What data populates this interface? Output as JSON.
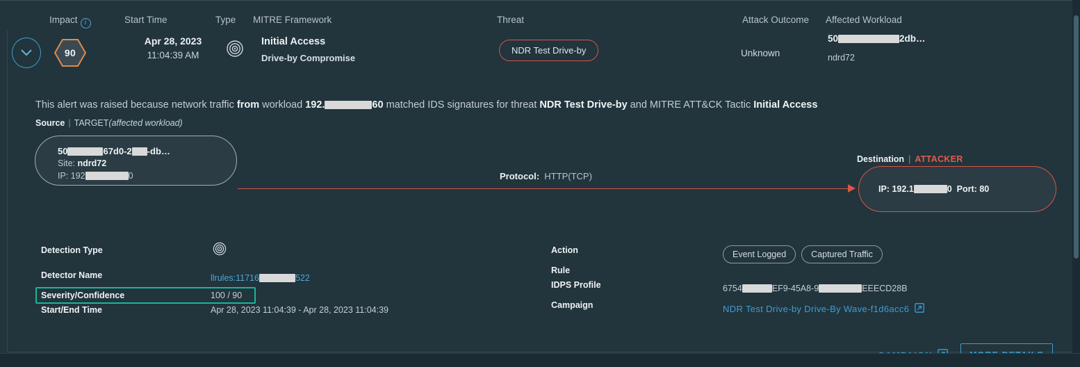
{
  "table_header": {
    "impact": "Impact",
    "impact_info_icon": "info-icon",
    "start_time": "Start Time",
    "type": "Type",
    "mitre_framework": "MITRE Framework",
    "threat": "Threat",
    "attack_outcome": "Attack Outcome",
    "affected_workload": "Affected Workload"
  },
  "row": {
    "expand_icon": "chevron-down-icon",
    "impact_score": "90",
    "start_date": "Apr 28, 2023",
    "start_time": "11:04:39 AM",
    "type_icon": "radar-target-icon",
    "mitre_tactic": "Initial Access",
    "mitre_technique": "Drive-by Compromise",
    "threat": "NDR Test Drive-by",
    "attack_outcome": "Unknown",
    "workload_id_prefix": "50",
    "workload_id_suffix": "2db…",
    "workload_site": "ndrd72"
  },
  "narrative": {
    "p1": "This alert was raised because network traffic ",
    "b1": "from",
    "p2": " workload ",
    "b2_prefix": "192.",
    "b2_suffix": "60",
    "p3": " matched IDS signatures for threat ",
    "b3": "NDR Test Drive-by",
    "p4": " and MITRE ATT&CK Tactic ",
    "b4": "Initial Access",
    "source_label": "Source",
    "target_label": "TARGET",
    "target_note": "(affected workload)"
  },
  "topology": {
    "source_node": {
      "name_prefix": "50",
      "name_mid": "67d0-2",
      "name_suffix": "-db…",
      "site_label": "Site:",
      "site_value": "ndrd72",
      "ip_label": "IP:",
      "ip_prefix": "192",
      "ip_suffix": "0"
    },
    "protocol_label": "Protocol:",
    "protocol_value": "HTTP(TCP)",
    "destination_label": "Destination",
    "destination_tag": "ATTACKER",
    "dest_node": {
      "ip_label": "IP:",
      "ip_prefix": "192.1",
      "ip_suffix": "0",
      "port_label": "Port:",
      "port_value": "80"
    }
  },
  "details_left": [
    {
      "label": "Detection Type",
      "value": "",
      "icon": "radar-target-icon"
    },
    {
      "label": "Detector Name",
      "value_prefix": "llrules:11716",
      "value_suffix": "522"
    },
    {
      "label": "Severity/Confidence",
      "value": "100 / 90",
      "highlighted": true
    },
    {
      "label": "Start/End Time",
      "value": "Apr 28, 2023 11:04:39 - Apr 28, 2023 11:04:39"
    }
  ],
  "details_right": [
    {
      "label": "Action",
      "chips": [
        "Event Logged",
        "Captured Traffic"
      ]
    },
    {
      "label": "Rule",
      "value": ""
    },
    {
      "label": "IDPS Profile",
      "value_prefix": "6754",
      "value_mid": "EF9-45A8-9",
      "value_suffix": "EEECD28B"
    },
    {
      "label": "Campaign",
      "value": "NDR Test Drive-by Drive-By Wave-f1d6acc6",
      "icon": "external-link-icon"
    }
  ],
  "footer": {
    "campaign_button": "CAMPAIGN",
    "campaign_icon": "external-link-icon",
    "more_details_button": "MORE DETAILS"
  },
  "colors": {
    "background": "#22343c",
    "page_background": "#1b2b33",
    "accent_blue": "#3c9fd4",
    "danger_red": "#d9554a",
    "impact_orange": "#e08a4e",
    "highlight_teal": "#19b69b",
    "border": "#324a53"
  }
}
